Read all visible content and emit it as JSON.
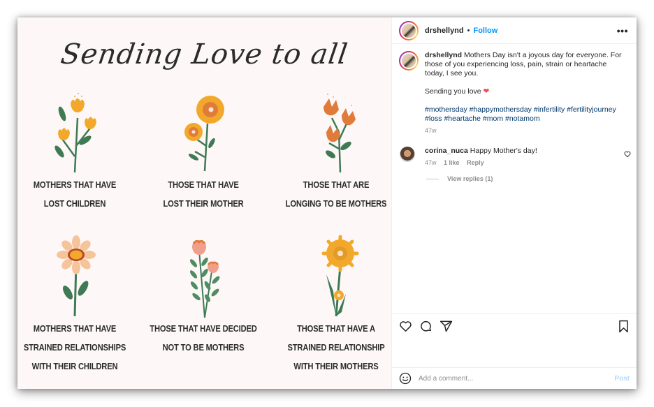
{
  "image": {
    "title": "Sending Love to all",
    "cells": [
      {
        "lines": [
          "MOTHERS THAT HAVE",
          "LOST CHILDREN"
        ],
        "flower": "yellow-tulips"
      },
      {
        "lines": [
          "THOSE THAT HAVE",
          "LOST THEIR MOTHER"
        ],
        "flower": "orange-poppies"
      },
      {
        "lines": [
          "THOSE THAT ARE",
          "LONGING TO BE MOTHERS"
        ],
        "flower": "orange-tulips"
      },
      {
        "lines": [
          "MOTHERS THAT HAVE",
          "STRAINED RELATIONSHIPS",
          "WITH THEIR CHILDREN"
        ],
        "flower": "peach-daisy"
      },
      {
        "lines": [
          "THOSE THAT HAVE DECIDED",
          "NOT TO BE MOTHERS"
        ],
        "flower": "pink-sprigs"
      },
      {
        "lines": [
          "THOSE THAT HAVE A",
          "STRAINED RELATIONSHIP",
          "WITH THEIR MOTHERS"
        ],
        "flower": "yellow-sunflower"
      }
    ]
  },
  "header": {
    "username": "drshellynd",
    "separator": "•",
    "follow_label": "Follow",
    "more_icon": "more-horizontal-icon",
    "more_label": "•••"
  },
  "caption": {
    "username": "drshellynd",
    "text": "Mothers Day isn't a joyous day for everyone. For those of you experiencing loss, pain, strain or heartache today, I see you.",
    "line2": "Sending you love",
    "heart": "❤",
    "hashtags": [
      "#mothersday",
      "#happymothersday",
      "#infertility",
      "#fertilityjourney",
      "#loss",
      "#heartache",
      "#mom",
      "#notamom"
    ],
    "time": "47w"
  },
  "comments": [
    {
      "username": "corina_nuca",
      "text": "Happy Mother's day!",
      "time": "47w",
      "likes": "1 like",
      "reply_label": "Reply",
      "view_replies": "View replies (1)"
    }
  ],
  "actions": {
    "icons": [
      "heart-icon",
      "comment-icon",
      "share-icon",
      "bookmark-icon"
    ]
  },
  "add_comment": {
    "placeholder": "Add a comment...",
    "post_label": "Post"
  },
  "colors": {
    "accent": "#0095f6",
    "link": "#00376b",
    "muted": "#8e8e8e",
    "post_disabled": "#b3dbff",
    "image_bg": "#fdf8f7"
  }
}
